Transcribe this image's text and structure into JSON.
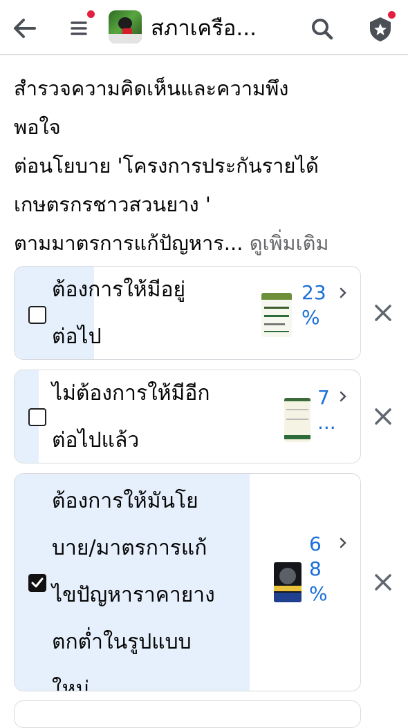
{
  "header": {
    "title": "สภาเครือ...",
    "back_icon": "back-arrow-icon",
    "menu_icon": "menu-icon",
    "search_icon": "search-icon",
    "shield_icon": "shield-icon",
    "notification_dot_color": "#e41e3f"
  },
  "poll": {
    "question_lines": [
      "สำรวจความคิดเห็นและความพึง",
      "พอใจ",
      "ต่อนโยบาย 'โครงการประกันรายได้",
      "เกษตรกรชาวสวนยาง '",
      "ตามมาตรการแก้ปัญหาร..."
    ],
    "see_more": "ดูเพิ่มเติม",
    "accent_color": "#1a6fd8",
    "fill_color": "#e6f0fc",
    "options": [
      {
        "label_lines": [
          "ต้องการให้มีอยู่",
          "ต่อไป"
        ],
        "percent_lines": [
          "23",
          "%"
        ],
        "percent": 23,
        "checked": false
      },
      {
        "label_lines": [
          "ไม่ต้องการให้มีอีก",
          "ต่อไปแล้ว"
        ],
        "percent_lines": [
          "7",
          "..."
        ],
        "percent": 7,
        "checked": false
      },
      {
        "label_lines": [
          "ต้องการให้มันโย",
          "บาย/มาตรการแก้",
          "ไขปัญหาราคายาง",
          "ตกต่ำในรูปแบบ",
          "ใหม่"
        ],
        "percent_lines": [
          "6",
          "8",
          "%"
        ],
        "percent": 68,
        "checked": true
      }
    ]
  }
}
